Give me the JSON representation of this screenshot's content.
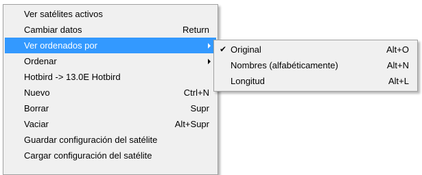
{
  "main_menu": {
    "items": [
      {
        "label": "Ver satélites activos",
        "shortcut": ""
      },
      {
        "label": "Cambiar datos",
        "shortcut": "Return"
      },
      {
        "label": "Ver ordenados por",
        "shortcut": "",
        "submenu_icon": "chevron-right-icon",
        "highlighted": true
      },
      {
        "label": "Ordenar",
        "shortcut": "",
        "submenu_icon": "chevron-right-icon"
      },
      {
        "label": "Hotbird -> 13.0E Hotbird",
        "shortcut": ""
      },
      {
        "label": "Nuevo",
        "shortcut": "Ctrl+N"
      },
      {
        "label": "Borrar",
        "shortcut": "Supr"
      },
      {
        "label": "Vaciar",
        "shortcut": "Alt+Supr"
      },
      {
        "label": "Guardar configuración del satélite",
        "shortcut": ""
      },
      {
        "label": "Cargar configuración del satélite",
        "shortcut": ""
      }
    ]
  },
  "sub_menu": {
    "items": [
      {
        "label": "Original",
        "shortcut": "Alt+O",
        "checked": true,
        "check_glyph": "✔"
      },
      {
        "label": "Nombres (alfabéticamente)",
        "shortcut": "Alt+N"
      },
      {
        "label": "Longitud",
        "shortcut": "Alt+L"
      }
    ]
  },
  "colors": {
    "menu_background": "#f0f0f0",
    "highlight": "#3399ff",
    "highlight_text": "#ffffff",
    "border": "#a0a0a0"
  }
}
